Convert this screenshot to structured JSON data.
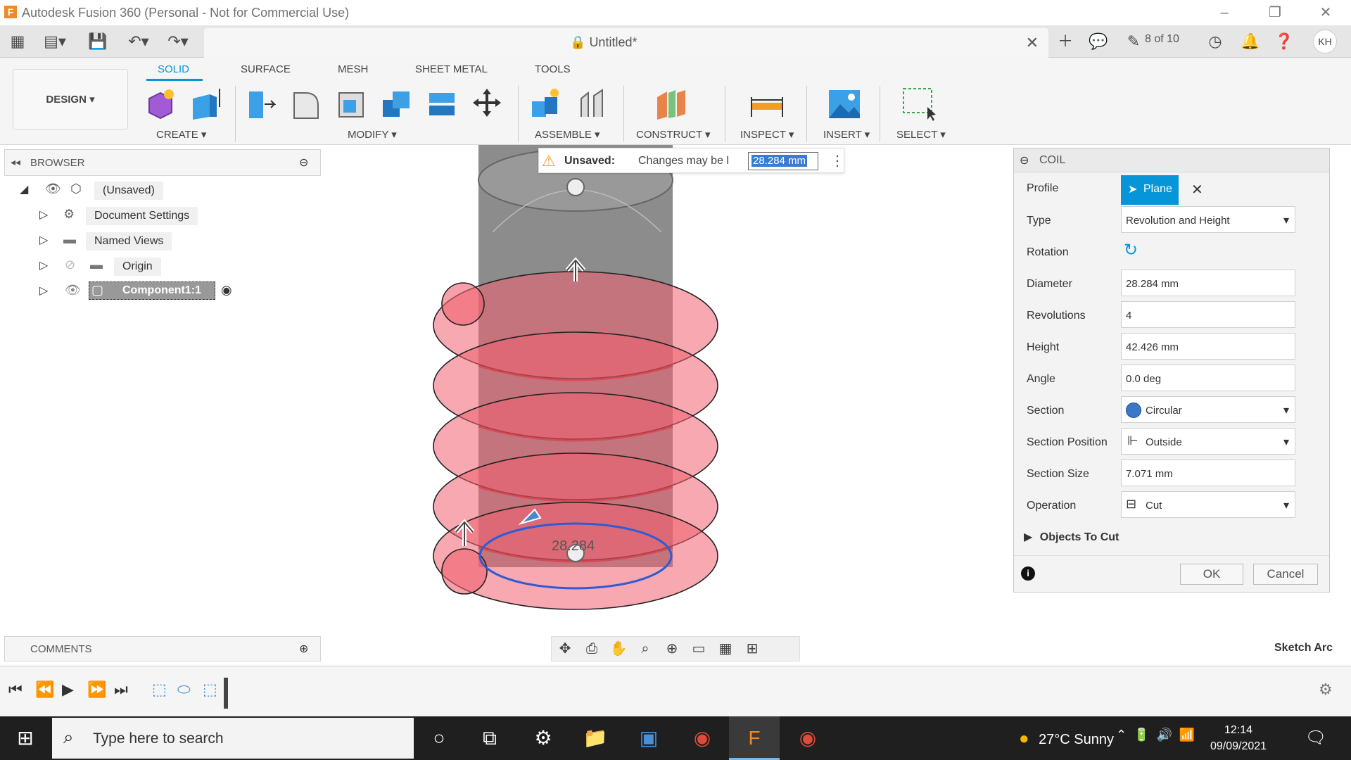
{
  "window": {
    "title": "Autodesk Fusion 360 (Personal - Not for Commercial Use)",
    "logo": "F"
  },
  "tabbar": {
    "doc_title": "Untitled*",
    "job_status": "8 of 10",
    "avatar": "KH"
  },
  "toolbar": {
    "workspace": "DESIGN ▾",
    "tabs": [
      "SOLID",
      "SURFACE",
      "MESH",
      "SHEET METAL",
      "TOOLS"
    ],
    "groups": {
      "create": "CREATE ▾",
      "modify": "MODIFY ▾",
      "assemble": "ASSEMBLE ▾",
      "construct": "CONSTRUCT ▾",
      "inspect": "INSPECT ▾",
      "insert": "INSERT ▾",
      "select": "SELECT ▾"
    }
  },
  "browser": {
    "label": "BROWSER",
    "items": [
      {
        "name": "(Unsaved)"
      },
      {
        "name": "Document Settings"
      },
      {
        "name": "Named Views"
      },
      {
        "name": "Origin"
      },
      {
        "name": "Component1:1"
      }
    ]
  },
  "notice": {
    "title": "Unsaved:",
    "message": "Changes may be l",
    "value": "28.284 mm"
  },
  "viewport": {
    "dimension_label": "28.284"
  },
  "coil": {
    "title": "COIL",
    "profile_label": "Profile",
    "profile_value": "Plane",
    "type_label": "Type",
    "type_value": "Revolution and Height",
    "rotation_label": "Rotation",
    "diameter_label": "Diameter",
    "diameter_value": "28.284 mm",
    "revolutions_label": "Revolutions",
    "revolutions_value": "4",
    "height_label": "Height",
    "height_value": "42.426 mm",
    "angle_label": "Angle",
    "angle_value": "0.0 deg",
    "section_label": "Section",
    "section_value": "Circular",
    "section_position_label": "Section Position",
    "section_position_value": "Outside",
    "section_size_label": "Section Size",
    "section_size_value": "7.071 mm",
    "operation_label": "Operation",
    "operation_value": "Cut",
    "objects_to_cut": "Objects To Cut",
    "ok": "OK",
    "cancel": "Cancel"
  },
  "comments": {
    "label": "COMMENTS"
  },
  "status": {
    "sketch_arc": "Sketch Arc"
  },
  "taskbar": {
    "search_placeholder": "Type here to search",
    "weather": "27°C  Sunny",
    "time": "12:14",
    "date": "09/09/2021"
  },
  "colors": {
    "accent": "#0696d7",
    "coil_fill": "#f06070",
    "body_gray": "#8a8a8a",
    "taskbar": "#1f1f1f"
  }
}
